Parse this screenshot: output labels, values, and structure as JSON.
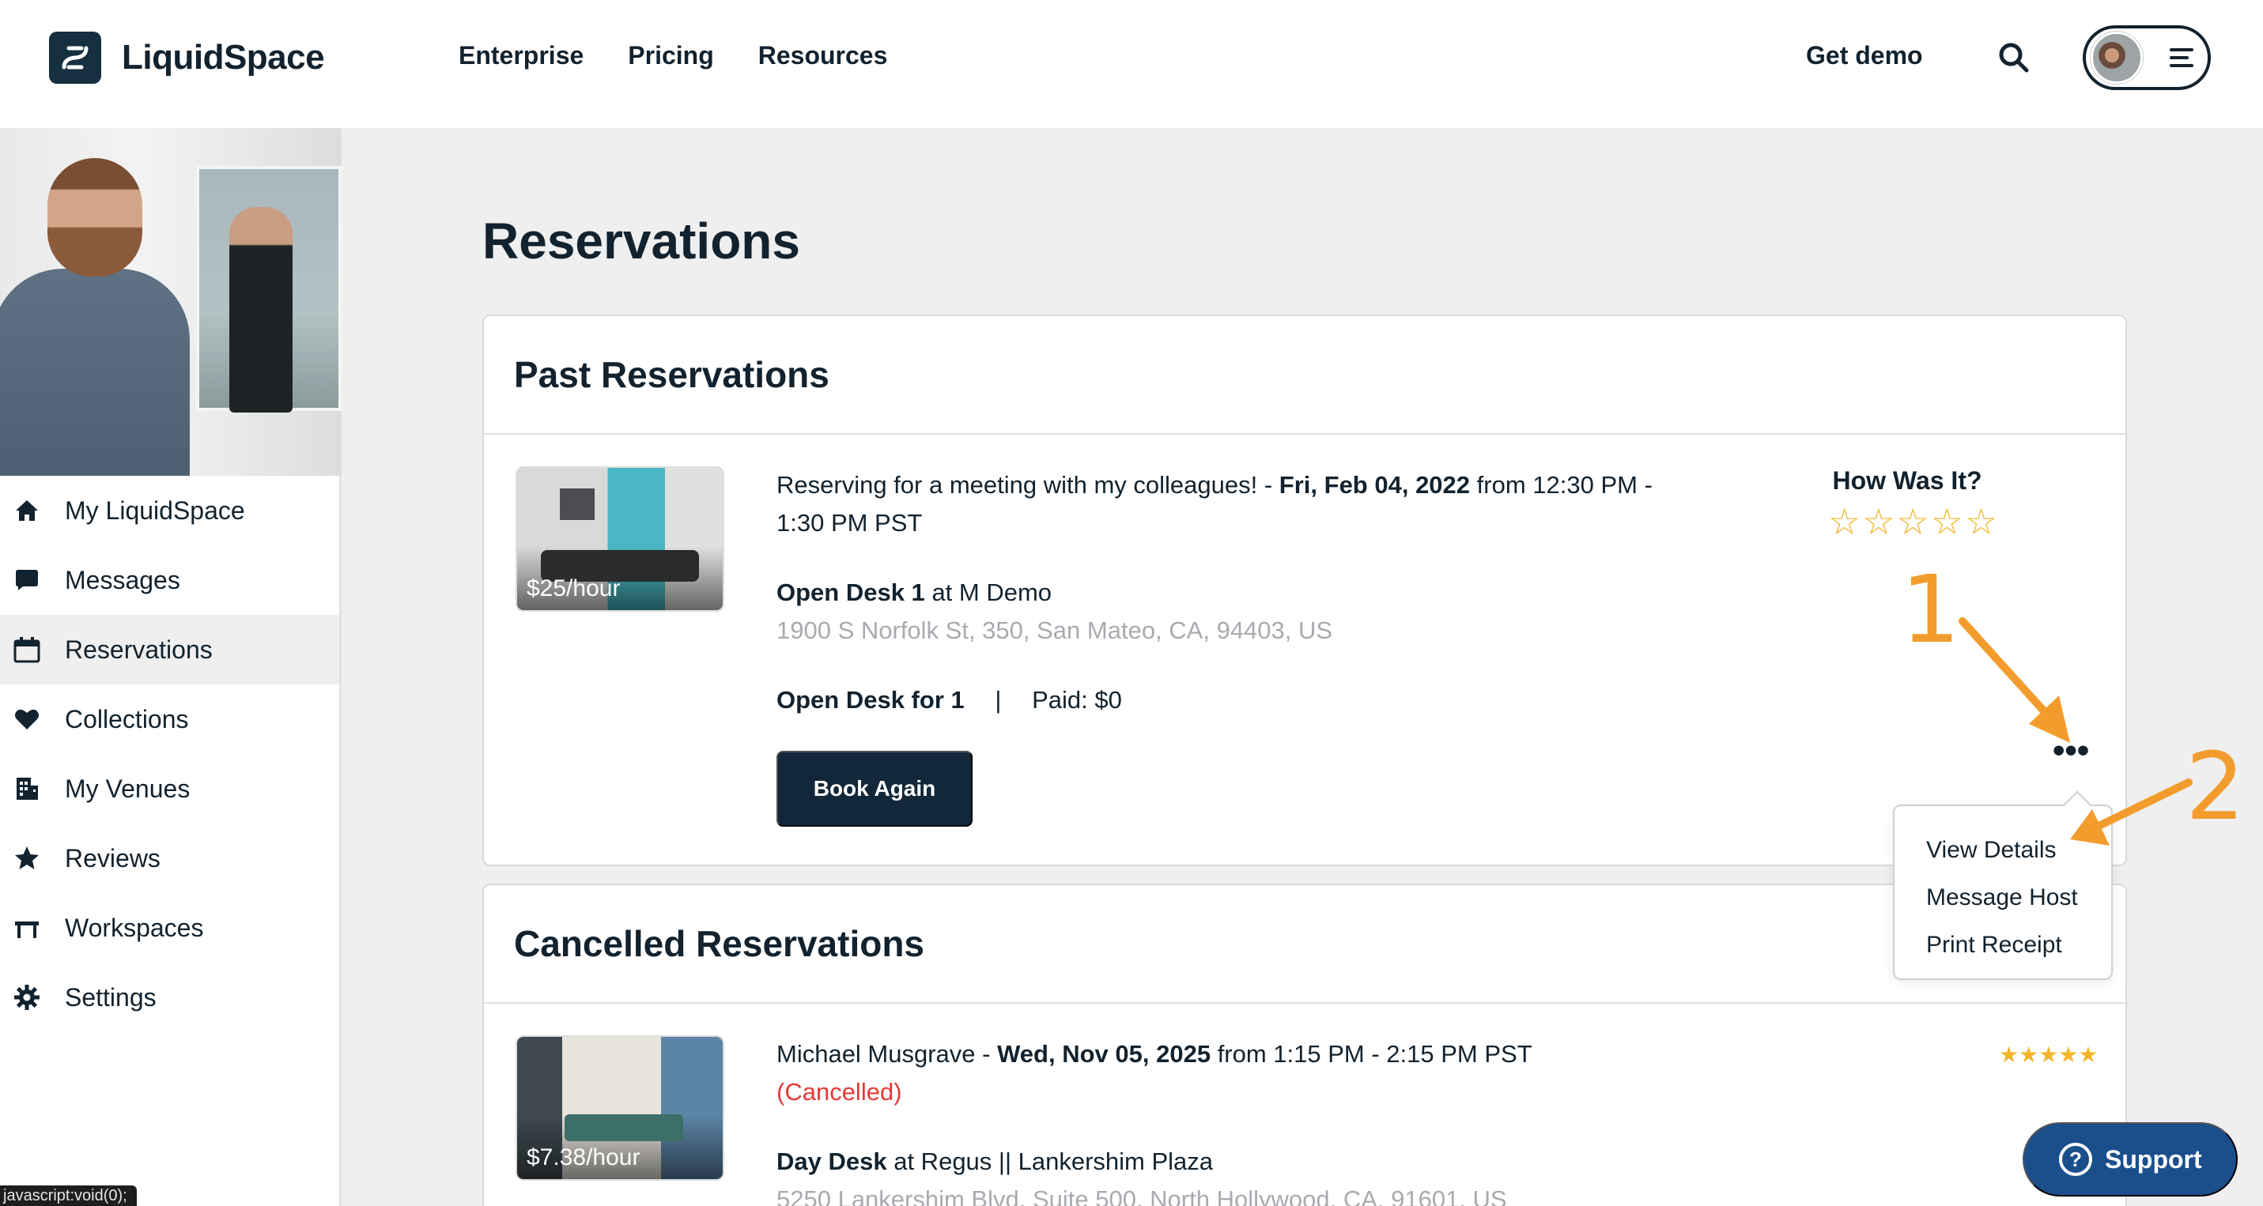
{
  "brand": {
    "name": "LiquidSpace"
  },
  "nav": {
    "links": [
      "Enterprise",
      "Pricing",
      "Resources"
    ],
    "get_demo": "Get demo"
  },
  "sidebar": {
    "items": [
      {
        "label": "My LiquidSpace",
        "icon": "home-icon"
      },
      {
        "label": "Messages",
        "icon": "chat-bubble-icon"
      },
      {
        "label": "Reservations",
        "icon": "calendar-icon",
        "active": true
      },
      {
        "label": "Collections",
        "icon": "heart-icon"
      },
      {
        "label": "My Venues",
        "icon": "building-icon"
      },
      {
        "label": "Reviews",
        "icon": "star-icon"
      },
      {
        "label": "Workspaces",
        "icon": "desk-icon"
      },
      {
        "label": "Settings",
        "icon": "gear-icon"
      }
    ]
  },
  "page": {
    "title": "Reservations"
  },
  "past": {
    "heading": "Past Reservations",
    "reservation": {
      "price": "$25/hour",
      "purpose": "Reserving for a meeting with my colleagues! -",
      "date": "Fri, Feb 04, 2022",
      "time_from": "from 12:30 PM -",
      "time_to": "1:30 PM PST",
      "space": "Open Desk 1",
      "venue": "at M Demo",
      "address": "1900 S Norfolk St, 350, San Mateo, CA, 94403, US",
      "booking": "Open Desk for 1",
      "separator": "|",
      "paid": "Paid: $0",
      "book_again": "Book Again",
      "rating_title": "How Was It?",
      "rating_stars": "☆☆☆☆☆",
      "more_actions": "•••"
    }
  },
  "dropdown": {
    "items": [
      "View Details",
      "Message Host",
      "Print Receipt"
    ]
  },
  "cancelled": {
    "heading": "Cancelled Reservations",
    "reservation": {
      "price": "$7.38/hour",
      "name": "Michael Musgrave -",
      "date": "Wed, Nov 05, 2025",
      "time": "from 1:15 PM - 2:15 PM PST",
      "status": "(Cancelled)",
      "space": "Day Desk",
      "venue": "at Regus || Lankershim Plaza",
      "address": "5250 Lankershim Blvd, Suite 500, North Hollywood, CA, 91601, US",
      "stars": "★★★★★"
    }
  },
  "annotations": [
    "1",
    "2"
  ],
  "support": {
    "label": "Support",
    "icon_glyph": "?"
  },
  "status_bar": "javascript:void(0);",
  "colors": {
    "accent": "#12283a",
    "star": "#f3b52a",
    "annotation": "#f39c2e",
    "cancelled": "#e53935",
    "support": "#1a4f8c"
  }
}
